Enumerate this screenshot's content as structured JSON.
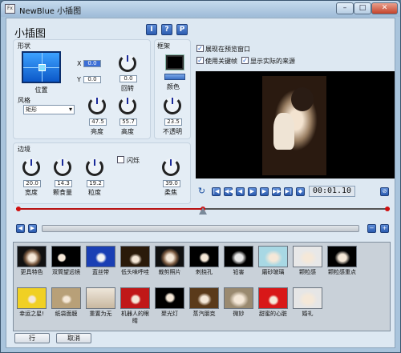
{
  "window": {
    "title": "NewBlue 小插图",
    "app_icon_text": "Fx",
    "minimize_icon": "minimize-icon",
    "maximize_icon": "maximize-icon",
    "close_icon": "close-icon"
  },
  "plugin": {
    "title": "小插图",
    "header_buttons": [
      "I",
      "?",
      "P"
    ]
  },
  "shape": {
    "label": "形状",
    "position_label": "位置",
    "x_label": "X",
    "x_value": "0.0",
    "y_label": "Y",
    "y_value": "0.0",
    "rotation_value": "0.0",
    "rotation_label": "回转",
    "style_label": "风格",
    "style_value": "矩形",
    "brightness_value": "47.5",
    "brightness_label": "亮度",
    "height_value": "55.7",
    "height_label": "高度"
  },
  "frame": {
    "label": "框架",
    "color_label": "颜色",
    "color_value": "#000000",
    "opacity_value": "23.5",
    "opacity_label": "不透明"
  },
  "border": {
    "label": "边境",
    "flash_label": "闪烁",
    "width_value": "20.0",
    "width_label": "宽度",
    "grain_value": "14.3",
    "grain_label": "颗食量",
    "granularity_value": "19.2",
    "granularity_label": "粒度",
    "softness_value": "39.0",
    "softness_label": "柔焦"
  },
  "options": {
    "show_in_preview": "展现在预览窗口",
    "use_keyframes": "使用关键帧",
    "show_source": "显示实际的来源"
  },
  "transport": {
    "timecode": "00:01.10"
  },
  "presets": [
    {
      "label": "更具特色"
    },
    {
      "label": "双筒望远镜"
    },
    {
      "label": "蓝丝带"
    },
    {
      "label": "低头味呼哇"
    },
    {
      "label": "裁剪照片"
    },
    {
      "label": "刺挠孔"
    },
    {
      "label": "铅害"
    },
    {
      "label": "磨砂玻璃"
    },
    {
      "label": "颗粒感"
    },
    {
      "label": "颗粒感重点"
    },
    {
      "label": "幸运之星!"
    },
    {
      "label": "纸袋面膜"
    },
    {
      "label": "重置为无"
    },
    {
      "label": "机器人的眼睛"
    },
    {
      "label": "聚光灯"
    },
    {
      "label": "蒸汽朋克"
    },
    {
      "label": "微妙"
    },
    {
      "label": "甜蜜的心脏"
    },
    {
      "label": "婚礼"
    }
  ],
  "footer": {
    "ok_label": "行",
    "cancel_label": "取消"
  }
}
